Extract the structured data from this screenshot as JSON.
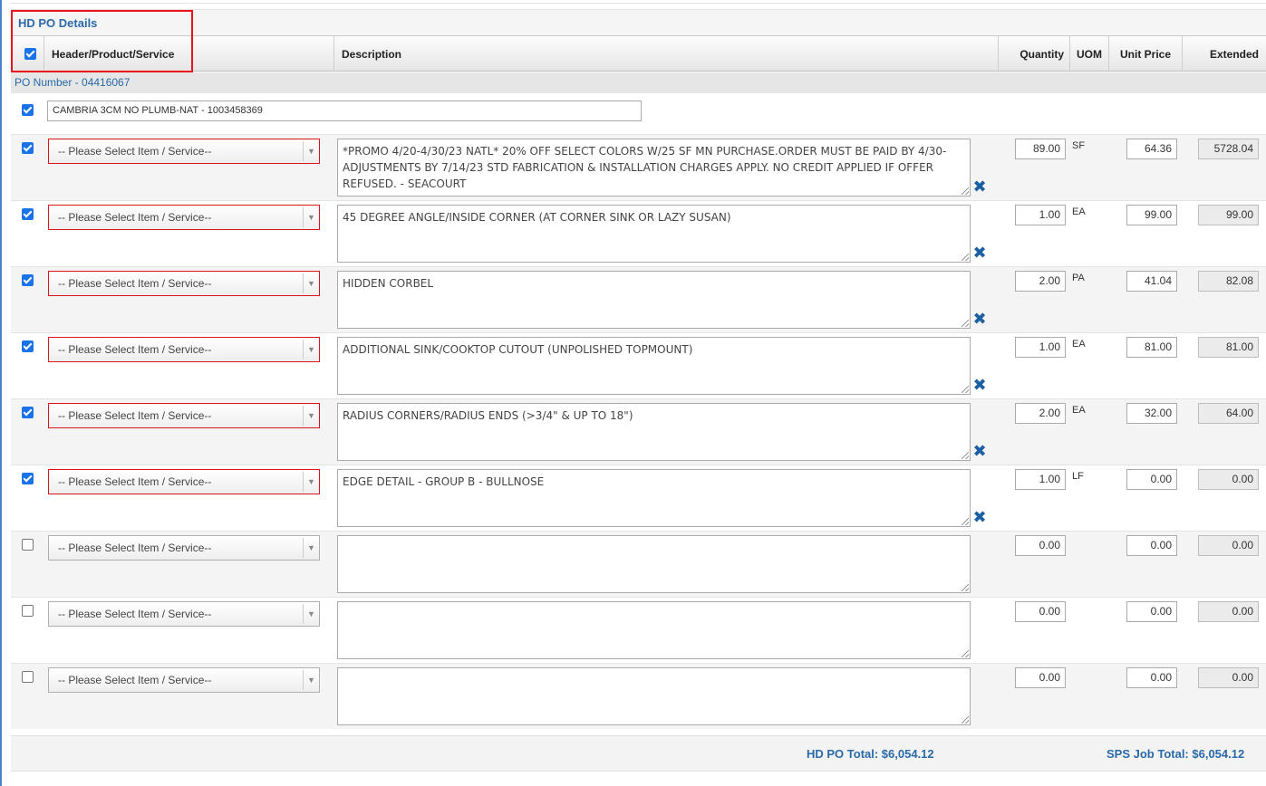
{
  "section_title": "HD PO Details",
  "columns": {
    "header_product_service": "Header/Product/Service",
    "description": "Description",
    "quantity": "Quantity",
    "uom": "UOM",
    "unit_price": "Unit Price",
    "extended": "Extended"
  },
  "po_number": "PO Number - 04416067",
  "header_field_value": "CAMBRIA 3CM NO PLUMB-NAT - 1003458369",
  "lines": [
    {
      "checked": true,
      "select": "-- Please Select Item / Service--",
      "error": true,
      "description": "*PROMO 4/20-4/30/23 NATL* 20% OFF SELECT COLORS W/25 SF MN PURCHASE.ORDER MUST BE PAID BY 4/30- ADJUSTMENTS BY 7/14/23 STD FABRICATION & INSTALLATION CHARGES APPLY. NO CREDIT APPLIED IF OFFER REFUSED. - SEACOURT",
      "quantity": "89.00",
      "uom": "SF",
      "unit_price": "64.36",
      "extended": "5728.04",
      "deletable": true
    },
    {
      "checked": true,
      "select": "-- Please Select Item / Service--",
      "error": true,
      "description": "45 DEGREE ANGLE/INSIDE CORNER (AT CORNER SINK OR LAZY SUSAN)",
      "quantity": "1.00",
      "uom": "EA",
      "unit_price": "99.00",
      "extended": "99.00",
      "deletable": true
    },
    {
      "checked": true,
      "select": "-- Please Select Item / Service--",
      "error": true,
      "description": "HIDDEN CORBEL",
      "quantity": "2.00",
      "uom": "PA",
      "unit_price": "41.04",
      "extended": "82.08",
      "deletable": true
    },
    {
      "checked": true,
      "select": "-- Please Select Item / Service--",
      "error": true,
      "description": "ADDITIONAL SINK/COOKTOP CUTOUT (UNPOLISHED TOPMOUNT)",
      "quantity": "1.00",
      "uom": "EA",
      "unit_price": "81.00",
      "extended": "81.00",
      "deletable": true
    },
    {
      "checked": true,
      "select": "-- Please Select Item / Service--",
      "error": true,
      "description": "RADIUS CORNERS/RADIUS ENDS (>3/4\" & UP TO 18\")",
      "quantity": "2.00",
      "uom": "EA",
      "unit_price": "32.00",
      "extended": "64.00",
      "deletable": true
    },
    {
      "checked": true,
      "select": "-- Please Select Item / Service--",
      "error": true,
      "description": "EDGE DETAIL - GROUP B - BULLNOSE",
      "quantity": "1.00",
      "uom": "LF",
      "unit_price": "0.00",
      "extended": "0.00",
      "deletable": true
    },
    {
      "checked": false,
      "select": "-- Please Select Item / Service--",
      "error": false,
      "description": "",
      "quantity": "0.00",
      "uom": "",
      "unit_price": "0.00",
      "extended": "0.00",
      "deletable": false
    },
    {
      "checked": false,
      "select": "-- Please Select Item / Service--",
      "error": false,
      "description": "",
      "quantity": "0.00",
      "uom": "",
      "unit_price": "0.00",
      "extended": "0.00",
      "deletable": false
    },
    {
      "checked": false,
      "select": "-- Please Select Item / Service--",
      "error": false,
      "description": "",
      "quantity": "0.00",
      "uom": "",
      "unit_price": "0.00",
      "extended": "0.00",
      "deletable": false
    }
  ],
  "totals": {
    "hd_po_total": "HD PO Total:  $6,054.12",
    "sps_job_total": "SPS Job Total:  $6,054.12"
  },
  "icons": {
    "delete": "close-x-icon",
    "dropdown": "chevron-down-icon"
  },
  "colors": {
    "accent": "#2a6aa8",
    "error_border": "#d9161e",
    "delete_icon": "#1c5fa3"
  }
}
